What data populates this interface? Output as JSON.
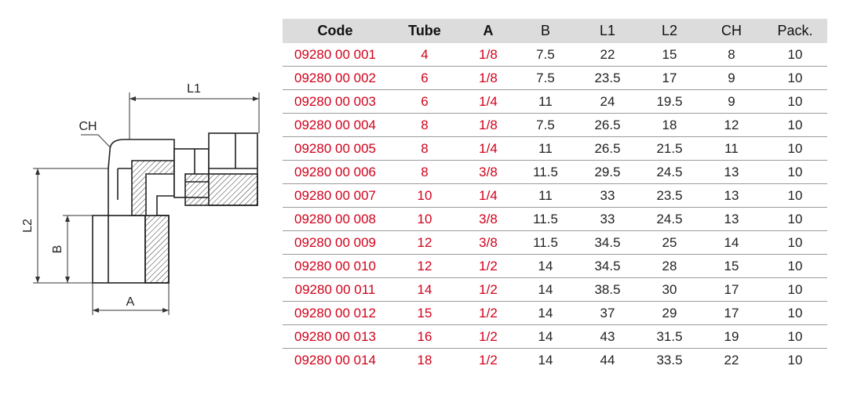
{
  "drawing": {
    "labels": {
      "l1": "L1",
      "l2": "L2",
      "ch": "CH",
      "a": "A",
      "b": "B"
    }
  },
  "table": {
    "headers": [
      "Code",
      "Tube",
      "A",
      "B",
      "L1",
      "L2",
      "CH",
      "Pack."
    ],
    "rows": [
      [
        "09280 00 001",
        "4",
        "1/8",
        "7.5",
        "22",
        "15",
        "8",
        "10"
      ],
      [
        "09280 00 002",
        "6",
        "1/8",
        "7.5",
        "23.5",
        "17",
        "9",
        "10"
      ],
      [
        "09280 00 003",
        "6",
        "1/4",
        "11",
        "24",
        "19.5",
        "9",
        "10"
      ],
      [
        "09280 00 004",
        "8",
        "1/8",
        "7.5",
        "26.5",
        "18",
        "12",
        "10"
      ],
      [
        "09280 00 005",
        "8",
        "1/4",
        "11",
        "26.5",
        "21.5",
        "11",
        "10"
      ],
      [
        "09280 00 006",
        "8",
        "3/8",
        "11.5",
        "29.5",
        "24.5",
        "13",
        "10"
      ],
      [
        "09280 00 007",
        "10",
        "1/4",
        "11",
        "33",
        "23.5",
        "13",
        "10"
      ],
      [
        "09280 00 008",
        "10",
        "3/8",
        "11.5",
        "33",
        "24.5",
        "13",
        "10"
      ],
      [
        "09280 00 009",
        "12",
        "3/8",
        "11.5",
        "34.5",
        "25",
        "14",
        "10"
      ],
      [
        "09280 00 010",
        "12",
        "1/2",
        "14",
        "34.5",
        "28",
        "15",
        "10"
      ],
      [
        "09280 00 011",
        "14",
        "1/2",
        "14",
        "38.5",
        "30",
        "17",
        "10"
      ],
      [
        "09280 00 012",
        "15",
        "1/2",
        "14",
        "37",
        "29",
        "17",
        "10"
      ],
      [
        "09280 00 013",
        "16",
        "1/2",
        "14",
        "43",
        "31.5",
        "19",
        "10"
      ],
      [
        "09280 00 014",
        "18",
        "1/2",
        "14",
        "44",
        "33.5",
        "22",
        "10"
      ]
    ]
  },
  "colors": {
    "code_red": "#d0021b",
    "header_bg": "#dcdcdc"
  }
}
